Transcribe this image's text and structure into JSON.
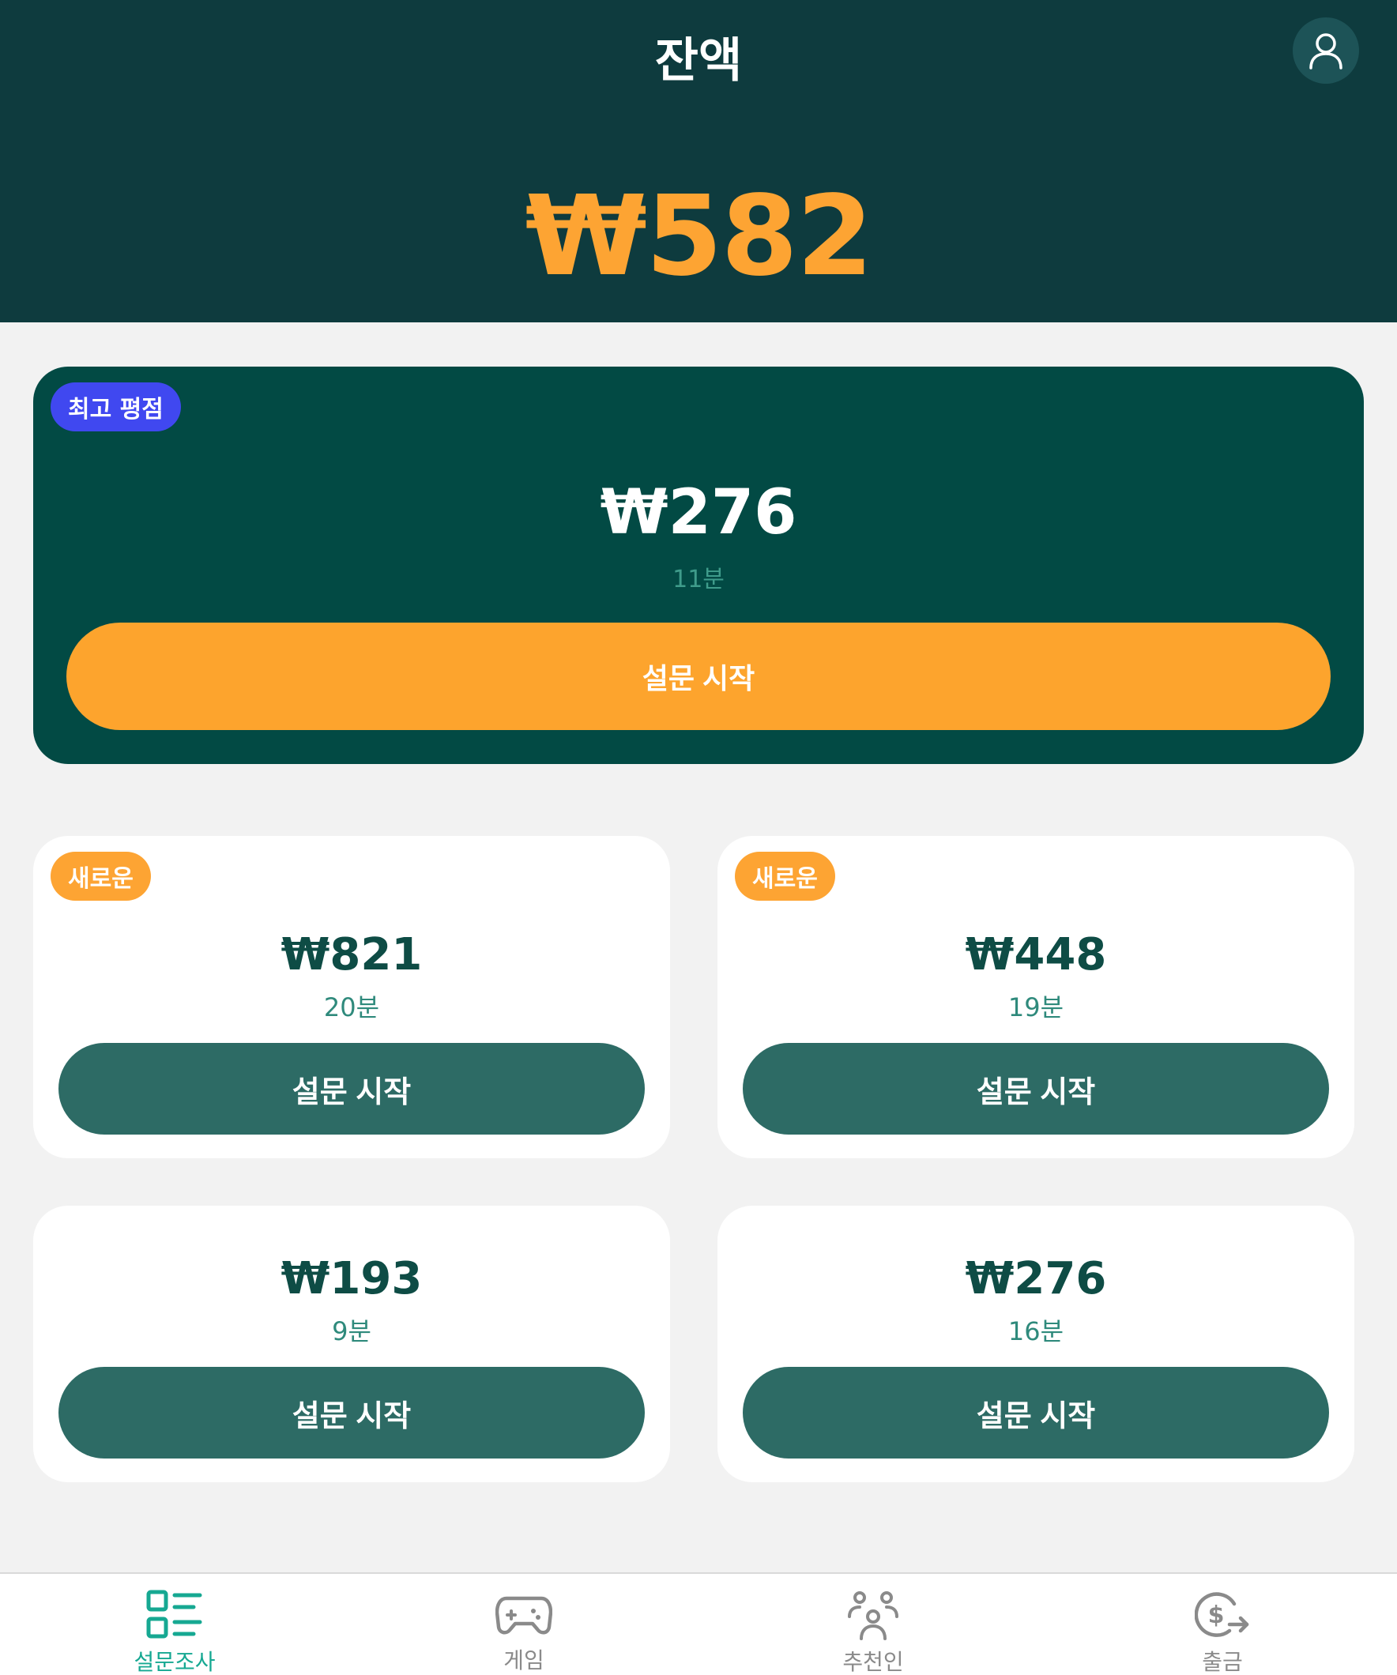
{
  "header": {
    "title": "잔액",
    "balance": "₩582"
  },
  "featured": {
    "badge": "최고 평점",
    "amount": "₩276",
    "duration": "11분",
    "button_label": "설문 시작"
  },
  "surveys": [
    {
      "badge": "새로운",
      "amount": "₩821",
      "duration": "20분",
      "button_label": "설문 시작"
    },
    {
      "badge": "새로운",
      "amount": "₩448",
      "duration": "19분",
      "button_label": "설문 시작"
    },
    {
      "amount": "₩193",
      "duration": "9분",
      "button_label": "설문 시작"
    },
    {
      "amount": "₩276",
      "duration": "16분",
      "button_label": "설문 시작"
    }
  ],
  "bottom_nav": {
    "items": [
      {
        "label": "설문조사",
        "icon": "survey-list-icon",
        "active": true
      },
      {
        "label": "게임",
        "icon": "gamepad-icon",
        "active": false
      },
      {
        "label": "추천인",
        "icon": "referral-people-icon",
        "active": false
      },
      {
        "label": "출금",
        "icon": "withdraw-dollar-icon",
        "active": false
      }
    ]
  },
  "colors": {
    "header_bg": "#0e3b3e",
    "balance": "#fda433",
    "featured_bg": "#024a44",
    "primary_orange": "#fda42d",
    "card_button": "#2d6b65",
    "badge_top": "#4048f0",
    "nav_active": "#16a892"
  }
}
